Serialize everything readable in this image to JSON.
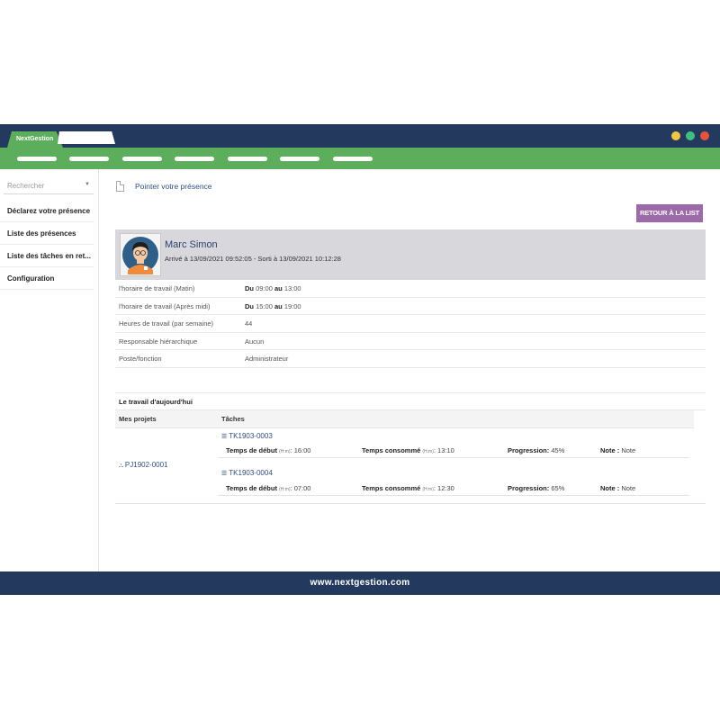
{
  "window": {
    "tab_label": "NextGestion",
    "dot_colors": [
      "#f4c542",
      "#3fbf7f",
      "#e5533d"
    ]
  },
  "sidebar": {
    "search_placeholder": "Rechercher",
    "items": [
      {
        "label": "Déclarez votre présence"
      },
      {
        "label": "Liste des présences"
      },
      {
        "label": "Liste des tâches en ret..."
      },
      {
        "label": "Configuration"
      }
    ]
  },
  "main": {
    "breadcrumb": "Pointer votre présence",
    "back_button": "RETOUR À LA LIST",
    "profile": {
      "name": "Marc Simon",
      "subtitle": "Arrivé à 13/09/2021 09:52:05 - Sorti à 13/09/2021 10:12:28"
    },
    "info": [
      {
        "label": "l'horaire de travail (Matin)",
        "du": "Du",
        "from": "09:00",
        "au": "au",
        "to": "13:00"
      },
      {
        "label": "l'horaire de travail (Après midi)",
        "du": "Du",
        "from": "15:00",
        "au": "au",
        "to": "19:00"
      },
      {
        "label": "Heures de travail (par semaine)",
        "value": "44"
      },
      {
        "label": "Responsable hiérarchique",
        "value": "Aucun"
      },
      {
        "label": "Poste/fonction",
        "value": "Administrateur"
      }
    ],
    "work": {
      "title": "Le travail d'aujourd'hui",
      "col_projects": "Mes projets",
      "col_tasks": "Tâches",
      "project": "PJ1902-0001",
      "tasks": [
        {
          "ref": "TK1903-0003",
          "start_label": "Temps de début",
          "unit": "(H:m)",
          "start": ": 16:00",
          "consumed_label": "Temps consommé",
          "consumed": ": 13:10",
          "progress_label": "Progression:",
          "progress": "45%",
          "note_label": "Note :",
          "note": "Note"
        },
        {
          "ref": "TK1903-0004",
          "start_label": "Temps de début",
          "unit": "(H:m)",
          "start": ": 07:00",
          "consumed_label": "Temps consommé",
          "consumed": ": 12:30",
          "progress_label": "Progression:",
          "progress": "65%",
          "note_label": "Note :",
          "note": "Note"
        }
      ]
    }
  },
  "footer": {
    "text": "www.nextgestion.com"
  }
}
